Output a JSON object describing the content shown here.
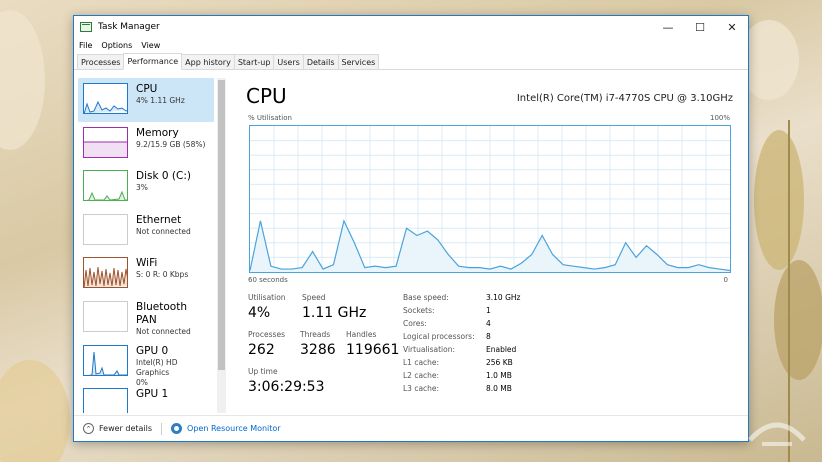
{
  "window": {
    "title": "Task Manager",
    "minimize_glyph": "—",
    "maximize_glyph": "☐",
    "close_glyph": "✕"
  },
  "menu": [
    "File",
    "Options",
    "View"
  ],
  "tabs": [
    {
      "label": "Processes",
      "active": false
    },
    {
      "label": "Performance",
      "active": true
    },
    {
      "label": "App history",
      "active": false
    },
    {
      "label": "Start-up",
      "active": false
    },
    {
      "label": "Users",
      "active": false
    },
    {
      "label": "Details",
      "active": false
    },
    {
      "label": "Services",
      "active": false
    }
  ],
  "sidebar": {
    "items": [
      {
        "name": "CPU",
        "sub": "4% 1.11 GHz",
        "color": "#1e79c9",
        "active": true
      },
      {
        "name": "Memory",
        "sub": "9.2/15.9 GB (58%)",
        "color": "#9b2fae",
        "active": false
      },
      {
        "name": "Disk 0 (C:)",
        "sub": "3%",
        "color": "#4caf50",
        "active": false
      },
      {
        "name": "Ethernet",
        "sub": "Not connected",
        "color": "#b0b0b0",
        "active": false
      },
      {
        "name": "WiFi",
        "sub": "S: 0 R: 0 Kbps",
        "color": "#a0522d",
        "active": false
      },
      {
        "name": "Bluetooth PAN",
        "sub": "Not connected",
        "color": "#b0b0b0",
        "active": false
      },
      {
        "name": "GPU 0",
        "sub": "Intel(R) HD Graphics",
        "sub2": "0%",
        "color": "#1e79c9",
        "active": false
      },
      {
        "name": "GPU 1",
        "sub": "",
        "color": "#1e79c9",
        "active": false
      }
    ]
  },
  "main": {
    "title": "CPU",
    "model": "Intel(R) Core(TM) i7-4770S CPU @ 3.10GHz",
    "ylabel": "% Utilisation",
    "ymax": "100%",
    "x_left": "60 seconds",
    "x_right": "0",
    "stats": {
      "utilisation_label": "Utilisation",
      "utilisation": "4%",
      "speed_label": "Speed",
      "speed": "1.11 GHz",
      "processes_label": "Processes",
      "processes": "262",
      "threads_label": "Threads",
      "threads": "3286",
      "handles_label": "Handles",
      "handles": "119661",
      "uptime_label": "Up time",
      "uptime": "3:06:29:53"
    },
    "details": [
      {
        "label": "Base speed:",
        "value": "3.10 GHz"
      },
      {
        "label": "Sockets:",
        "value": "1"
      },
      {
        "label": "Cores:",
        "value": "4"
      },
      {
        "label": "Logical processors:",
        "value": "8"
      },
      {
        "label": "Virtualisation:",
        "value": "Enabled"
      },
      {
        "label": "L1 cache:",
        "value": "256 KB"
      },
      {
        "label": "L2 cache:",
        "value": "1.0 MB"
      },
      {
        "label": "L3 cache:",
        "value": "8.0 MB"
      }
    ],
    "cpu_history_percent": [
      1,
      35,
      4,
      2,
      2,
      3,
      14,
      2,
      5,
      35,
      20,
      3,
      4,
      3,
      4,
      30,
      25,
      28,
      22,
      12,
      4,
      3,
      3,
      2,
      4,
      2,
      6,
      12,
      25,
      12,
      5,
      4,
      3,
      2,
      3,
      5,
      20,
      10,
      18,
      12,
      5,
      3,
      3,
      5,
      3,
      2,
      1
    ],
    "accent_color": "#4aa3dc"
  },
  "footer": {
    "fewer_details": "Fewer details",
    "open_resmon": "Open Resource Monitor"
  }
}
